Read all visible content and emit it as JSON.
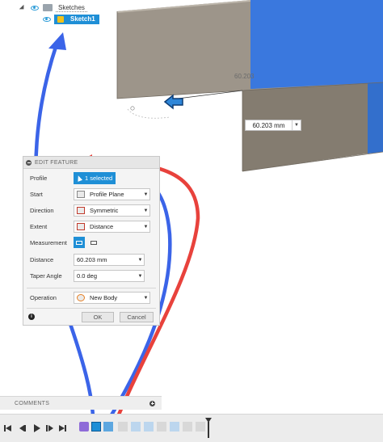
{
  "browser": {
    "sketches_label": "Sketches",
    "sketch_item_label": "Sketch1"
  },
  "viewport": {
    "dimension_label": "60.203",
    "dimension_input_value": "60.203 mm"
  },
  "dialog": {
    "title": "EDIT FEATURE",
    "rows": {
      "profile": {
        "label": "Profile",
        "value": "1 selected"
      },
      "start": {
        "label": "Start",
        "value": "Profile Plane"
      },
      "direction": {
        "label": "Direction",
        "value": "Symmetric"
      },
      "extent": {
        "label": "Extent",
        "value": "Distance"
      },
      "measurement": {
        "label": "Measurement"
      },
      "distance": {
        "label": "Distance",
        "value": "60.203 mm"
      },
      "taper": {
        "label": "Taper Angle",
        "value": "0.0 deg"
      },
      "operation": {
        "label": "Operation",
        "value": "New Body"
      }
    },
    "ok_label": "OK",
    "cancel_label": "Cancel"
  },
  "comments": {
    "label": "COMMENTS"
  },
  "colors": {
    "accent": "#1f8fd6",
    "face_blue": "#2e6fd1",
    "body_gray": "#8b8378",
    "arrow_blue": "#3b64e8",
    "arrow_red": "#e8423c"
  }
}
